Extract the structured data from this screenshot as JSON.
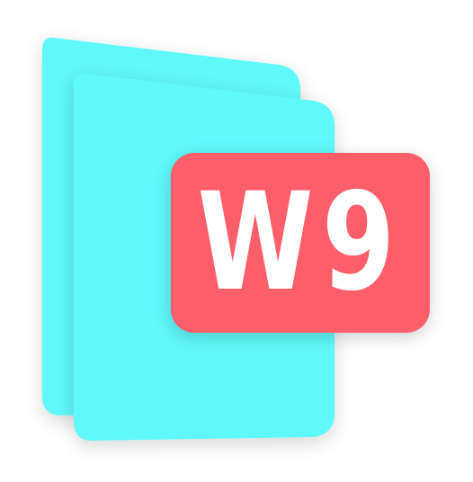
{
  "icon": {
    "name": "w9-document-icon",
    "badge_text": "W9",
    "colors": {
      "page": "#5ff8fb",
      "badge": "#fc5f6a",
      "badge_text": "#ffffff",
      "background": "#ffffff"
    }
  }
}
